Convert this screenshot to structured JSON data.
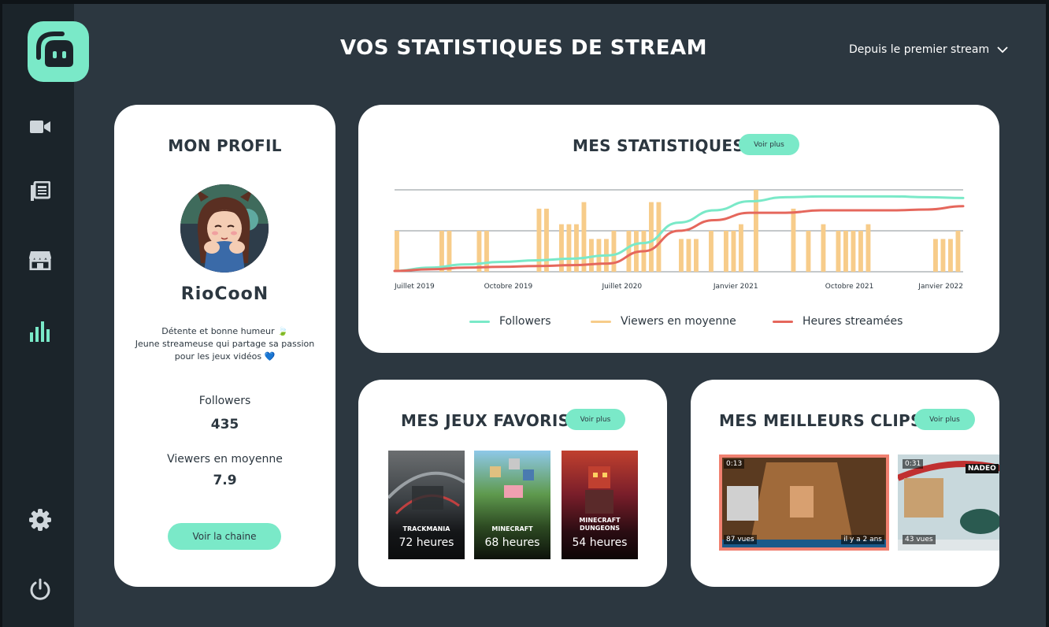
{
  "header": {
    "title": "VOS STATISTIQUES DE STREAM",
    "period_selector": "Depuis le premier stream"
  },
  "sidebar": {
    "items": [
      {
        "icon": "video-camera-icon"
      },
      {
        "icon": "newspaper-icon"
      },
      {
        "icon": "store-icon"
      },
      {
        "icon": "bar-chart-icon",
        "active": true
      },
      {
        "icon": "gear-icon"
      },
      {
        "icon": "power-icon"
      }
    ]
  },
  "profile": {
    "title": "MON PROFIL",
    "username": "RioCooN",
    "bio_line1": "Détente et bonne humeur 🍃",
    "bio_line2": "Jeune streameuse qui partage sa passion",
    "bio_line3": "pour les jeux vidéos 💙",
    "followers_label": "Followers",
    "followers_value": "435",
    "viewers_label": "Viewers en moyenne",
    "viewers_value": "7.9",
    "channel_button": "Voir la chaine"
  },
  "stats": {
    "title": "MES STATISTIQUES",
    "more_button": "Voir plus",
    "legend": {
      "followers": "Followers",
      "viewers": "Viewers en moyenne",
      "hours": "Heures streamées"
    }
  },
  "chart_data": {
    "type": "bar",
    "x_tick_labels": [
      "Juillet 2019",
      "Octobre 2019",
      "Juillet 2020",
      "Janvier 2021",
      "Octobre 2021",
      "Janvier 2022"
    ],
    "colors": {
      "followers": "#7ae9c8",
      "viewers": "#f7cc8a",
      "hours": "#e5675c"
    },
    "grid": true,
    "ylim": [
      0,
      1
    ],
    "series": [
      {
        "name": "Viewers en moyenne",
        "kind": "bar",
        "values": [
          0.5,
          0,
          0,
          0,
          0,
          0,
          0.5,
          0.5,
          0,
          0,
          0,
          0.5,
          0.5,
          0,
          0,
          0,
          0,
          0,
          0,
          0.77,
          0.77,
          0,
          0.58,
          0.58,
          0.58,
          0.85,
          0.4,
          0.4,
          0.4,
          0.5,
          0,
          0.5,
          0.5,
          0.5,
          0.85,
          0.85,
          0,
          0,
          0.4,
          0.4,
          0.4,
          0,
          0.5,
          0,
          0.5,
          0.5,
          0.58,
          0,
          1,
          0,
          0,
          0,
          0,
          0.77,
          0,
          0.5,
          0,
          0.58,
          0,
          0.5,
          0.5,
          0.5,
          0.5,
          0.58,
          0,
          0,
          0,
          0,
          0,
          0,
          0,
          0,
          0.4,
          0.4,
          0.4,
          0.5
        ]
      },
      {
        "name": "Followers",
        "kind": "line",
        "values": [
          0.01,
          0.05,
          0.09,
          0.12,
          0.14,
          0.16,
          0.2,
          0.35,
          0.6,
          0.75,
          0.86,
          0.91,
          0.92,
          0.92,
          0.92,
          0.91,
          0.9
        ]
      },
      {
        "name": "Heures streamées",
        "kind": "line",
        "values": [
          0.01,
          0.03,
          0.05,
          0.06,
          0.07,
          0.08,
          0.1,
          0.25,
          0.5,
          0.63,
          0.72,
          0.72,
          0.75,
          0.75,
          0.75,
          0.76,
          0.8
        ]
      }
    ]
  },
  "games": {
    "title": "MES JEUX FAVORIS",
    "more_button": "Voir plus",
    "items": [
      {
        "name": "TRACKMANIA",
        "hours": "72 heures"
      },
      {
        "name": "MINECRAFT",
        "hours": "68 heures"
      },
      {
        "name": "MINECRAFT DUNGEONS",
        "hours": "54 heures"
      }
    ]
  },
  "clips": {
    "title": "MES MEILLEURS CLIPS",
    "more_button": "Voir plus",
    "items": [
      {
        "duration": "0:13",
        "views": "87 vues",
        "age": "il y a 2 ans"
      },
      {
        "duration": "0:31",
        "views": "43 vues",
        "badge": "NADEO"
      }
    ]
  }
}
